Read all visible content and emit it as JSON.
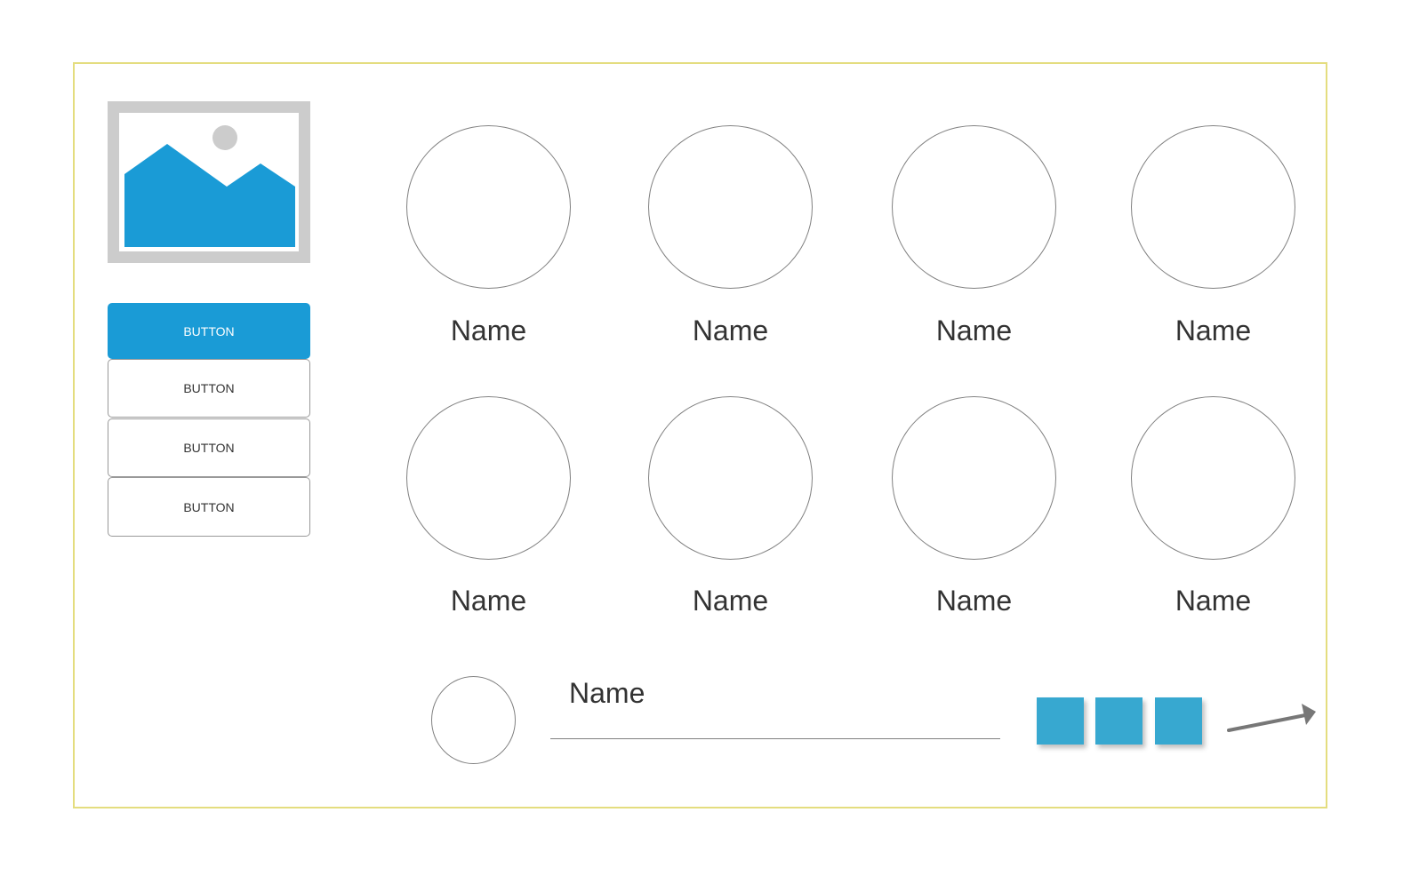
{
  "sidebar": {
    "image_icon": "image-placeholder-icon",
    "buttons": [
      {
        "label": "BUTTON",
        "active": true
      },
      {
        "label": "BUTTON",
        "active": false
      },
      {
        "label": "BUTTON",
        "active": false
      },
      {
        "label": "BUTTON",
        "active": false
      }
    ]
  },
  "grid": {
    "row1": [
      "Name",
      "Name",
      "Name",
      "Name"
    ],
    "row2": [
      "Name",
      "Name",
      "Name",
      "Name"
    ]
  },
  "footer": {
    "name": "Name",
    "squares_count": 3,
    "arrow_icon": "arrow-right-icon"
  },
  "colors": {
    "accent": "#1a9bd6",
    "square": "#37a8d0",
    "frame_border": "#e4dd7f",
    "outline": "#808080"
  }
}
